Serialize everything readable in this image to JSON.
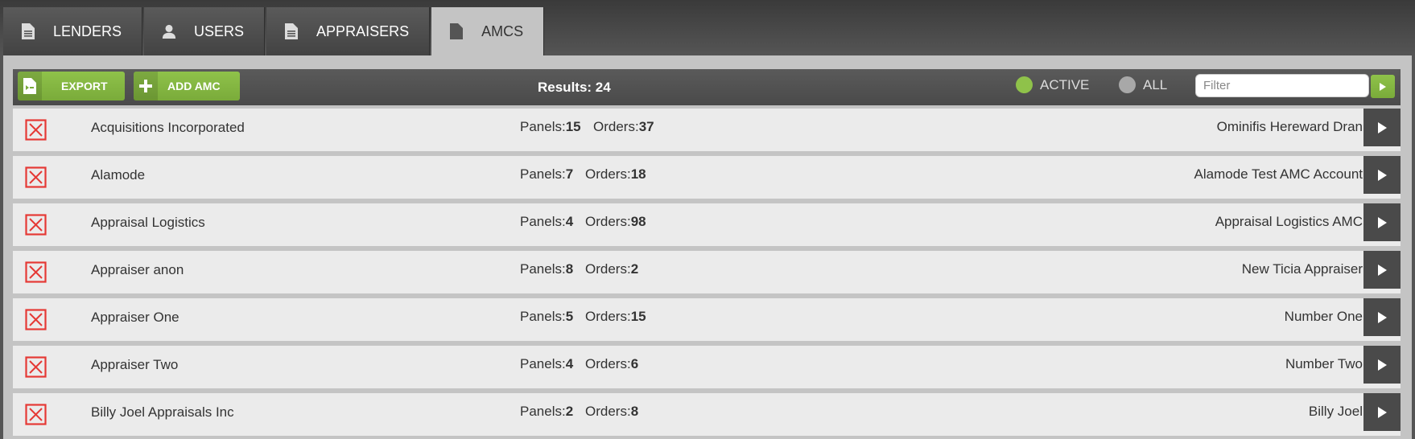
{
  "tabs": [
    {
      "label": "LENDERS",
      "icon": "document-icon"
    },
    {
      "label": "USERS",
      "icon": "user-icon"
    },
    {
      "label": "APPRAISERS",
      "icon": "document-icon"
    },
    {
      "label": "AMCS",
      "icon": "document-icon",
      "active": true
    }
  ],
  "toolbar": {
    "export_label": "EXPORT",
    "add_label": "ADD AMC",
    "results": "Results: 24",
    "active_label": "ACTIVE",
    "all_label": "ALL",
    "filter_placeholder": "Filter",
    "filter_value": ""
  },
  "labels": {
    "panels": "Panels:",
    "orders": "Orders:"
  },
  "colors": {
    "accent": "#8fc24a",
    "delete": "#e53935",
    "tab_active": "#c4c4c4"
  },
  "rows": [
    {
      "name": "Acquisitions Incorporated",
      "panels": "15",
      "orders": "37",
      "account": "Ominifis Hereward Dran"
    },
    {
      "name": "Alamode",
      "panels": "7",
      "orders": "18",
      "account": "Alamode Test AMC Account"
    },
    {
      "name": "Appraisal Logistics",
      "panels": "4",
      "orders": "98",
      "account": "Appraisal Logistics AMC"
    },
    {
      "name": "Appraiser anon",
      "panels": "8",
      "orders": "2",
      "account": "New Ticia Appraiser"
    },
    {
      "name": "Appraiser One",
      "panels": "5",
      "orders": "15",
      "account": "Number One"
    },
    {
      "name": "Appraiser Two",
      "panels": "4",
      "orders": "6",
      "account": "Number Two"
    },
    {
      "name": "Billy Joel Appraisals Inc",
      "panels": "2",
      "orders": "8",
      "account": "Billy Joel"
    }
  ]
}
